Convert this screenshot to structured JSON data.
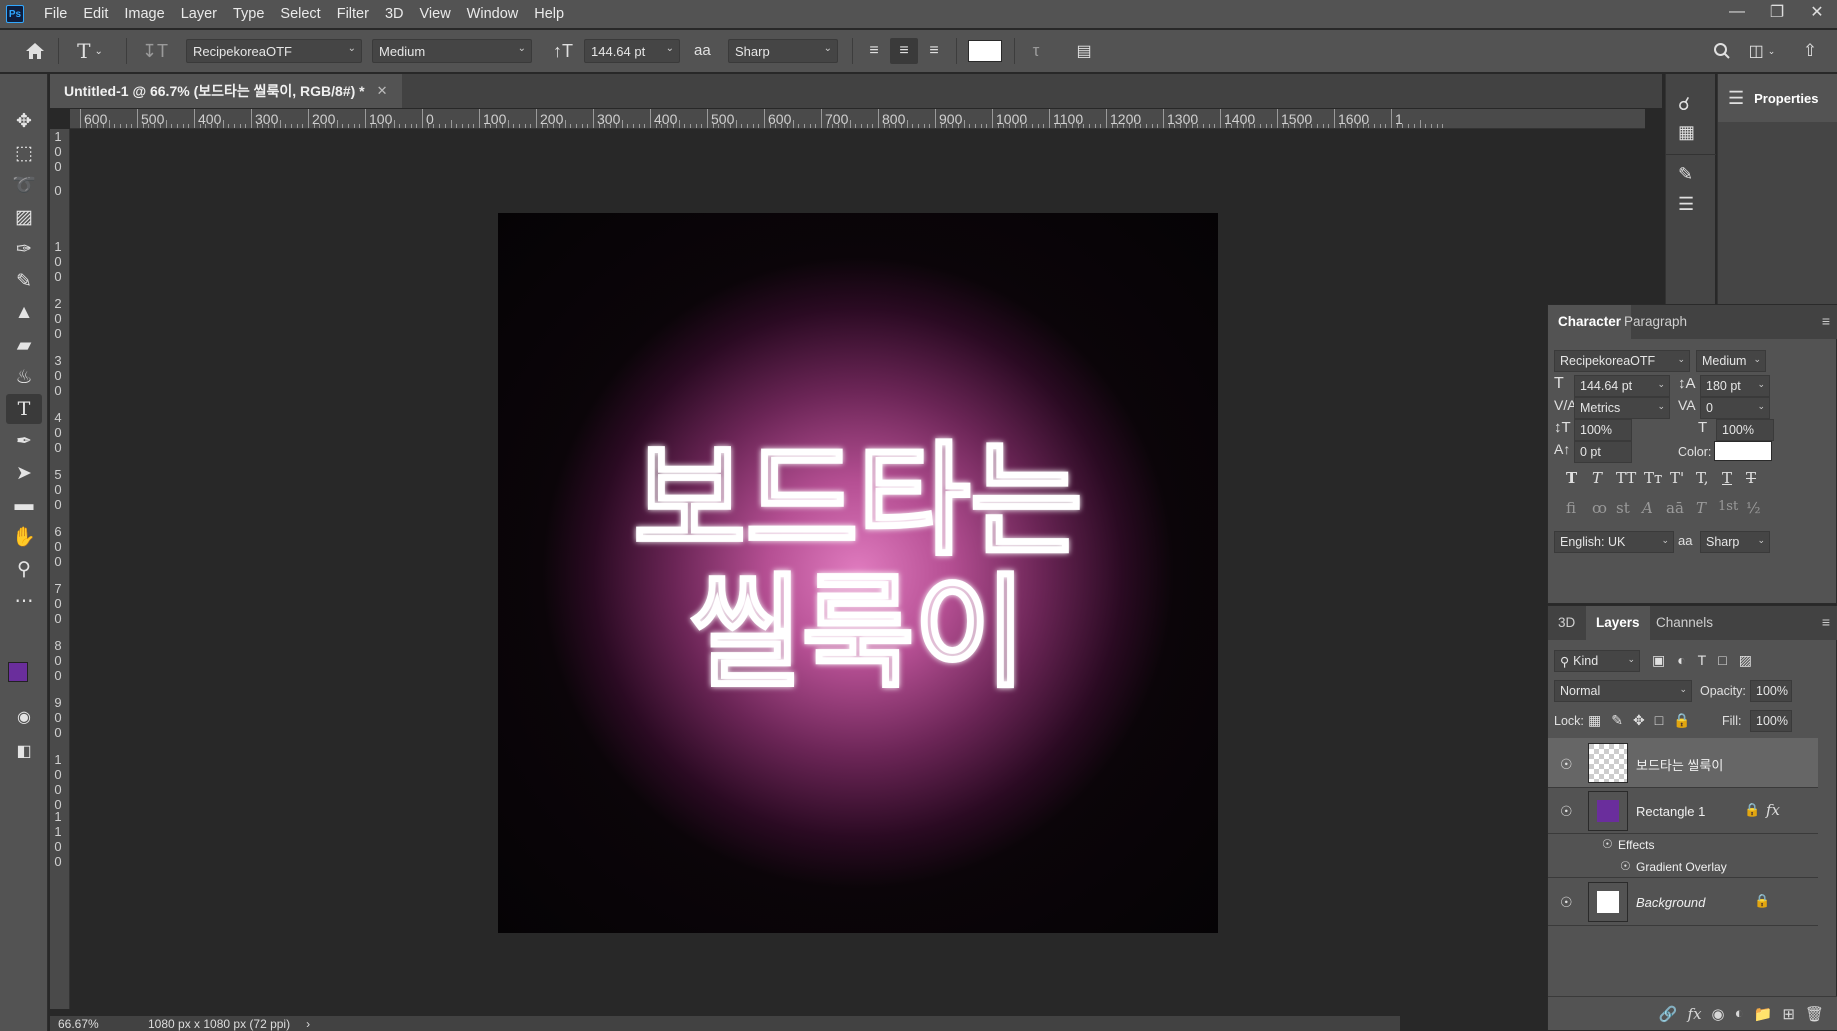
{
  "app": {
    "logo": "Ps",
    "menu": [
      "File",
      "Edit",
      "Image",
      "Layer",
      "Type",
      "Select",
      "Filter",
      "3D",
      "View",
      "Window",
      "Help"
    ]
  },
  "options": {
    "font_family": "RecipekoreaOTF",
    "font_style": "Medium",
    "font_size": "144.64 pt",
    "antialias_icon": "aa",
    "antialias": "Sharp"
  },
  "document": {
    "tab_title": "Untitled-1 @ 66.7% (보드타는 씰룩이, RGB/8#) *",
    "canvas_text_line1": "보드타는",
    "canvas_text_line2": "씰룩이"
  },
  "rulers": {
    "h_labels": [
      "600",
      "500",
      "400",
      "300",
      "200",
      "100",
      "0",
      "100",
      "200",
      "300",
      "400",
      "500",
      "600",
      "700",
      "800",
      "900",
      "1000",
      "1100",
      "1200",
      "1300",
      "1400",
      "1500",
      "1600",
      "1"
    ],
    "v_labels": [
      "1\n0\n0",
      "0",
      "1\n0\n0",
      "2\n0\n0",
      "3\n0\n0",
      "4\n0\n0",
      "5\n0\n0",
      "6\n0\n0",
      "7\n0\n0",
      "8\n0\n0",
      "9\n0\n0",
      "1\n0\n0\n0",
      "1\n1\n0\n0"
    ]
  },
  "status": {
    "zoom": "66.67%",
    "doc_size": "1080 px x 1080 px (72 ppi)"
  },
  "right": {
    "properties_label": "Properties"
  },
  "character": {
    "tabs": [
      "Character",
      "Paragraph"
    ],
    "font_family": "RecipekoreaOTF",
    "font_style": "Medium",
    "size": "144.64 pt",
    "leading": "180 pt",
    "kerning": "Metrics",
    "tracking": "0",
    "vscale": "100%",
    "hscale": "100%",
    "baseline": "0 pt",
    "color_label": "Color:",
    "color": "#ffffff",
    "type_buttons": [
      "T",
      "T",
      "TT",
      "Tт",
      "T'",
      "T,",
      "T",
      "T"
    ],
    "opentype_buttons": [
      "fi",
      "ꝏ",
      "st",
      "A",
      "aā",
      "T",
      "1st",
      "½"
    ],
    "language": "English: UK",
    "antialias": "Sharp"
  },
  "layers": {
    "tabs": [
      "3D",
      "Layers",
      "Channels"
    ],
    "filter": "Kind",
    "blend_mode": "Normal",
    "opacity_label": "Opacity:",
    "opacity": "100%",
    "lock_label": "Lock:",
    "fill_label": "Fill:",
    "fill": "100%",
    "items": [
      {
        "name": "보드타는 씰룩이"
      },
      {
        "name": "Rectangle 1",
        "fx": "fx",
        "effects_label": "Effects",
        "effect": "Gradient Overlay"
      },
      {
        "name": "Background"
      }
    ]
  },
  "colors": {
    "foreground": "#6a2e9c",
    "background": "#ffffff",
    "accent": "#31a8ff"
  }
}
